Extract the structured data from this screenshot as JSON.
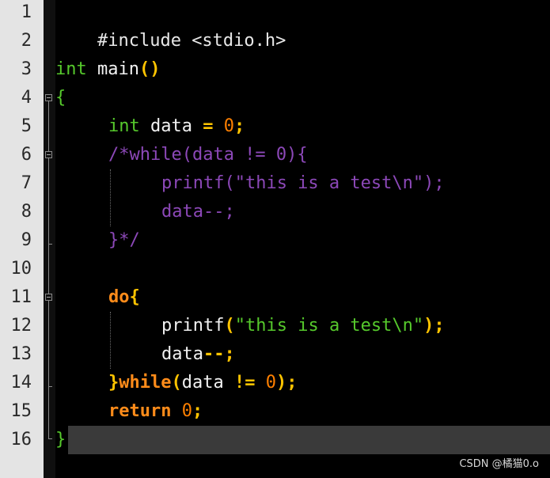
{
  "editor": {
    "line_numbers": [
      "1",
      "2",
      "3",
      "4",
      "5",
      "6",
      "7",
      "8",
      "9",
      "10",
      "11",
      "12",
      "13",
      "14",
      "15",
      "16"
    ]
  },
  "code": {
    "l1": {
      "pre": "#include <stdio.h>"
    },
    "l3": {
      "type": "int",
      "name": " main",
      "paren": "()"
    },
    "l4": {
      "brace": "{"
    },
    "l5": {
      "type": "int",
      "var": " data ",
      "op": "=",
      "num": " 0",
      "semi": ";"
    },
    "l6": {
      "comment": "/*while(data != 0){"
    },
    "l7": {
      "comment": "printf(\"this is a test\\n\");"
    },
    "l8": {
      "comment": "data--;"
    },
    "l9": {
      "comment": "}*/"
    },
    "l11": {
      "kw": "do",
      "brace": "{"
    },
    "l12": {
      "fn": "printf",
      "p1": "(",
      "str": "\"this is a test\\n\"",
      "p2": ")",
      "semi": ";"
    },
    "l13": {
      "var": "data",
      "op": "--",
      "semi": ";"
    },
    "l14": {
      "brace": "}",
      "kw": "while",
      "p1": "(",
      "var": "data ",
      "op": "!=",
      "num": " 0",
      "p2": ")",
      "semi": ";"
    },
    "l15": {
      "kw": "return",
      "num": " 0",
      "semi": ";"
    },
    "l16": {
      "brace": "}"
    }
  },
  "watermark": "CSDN @橘猫0.o"
}
